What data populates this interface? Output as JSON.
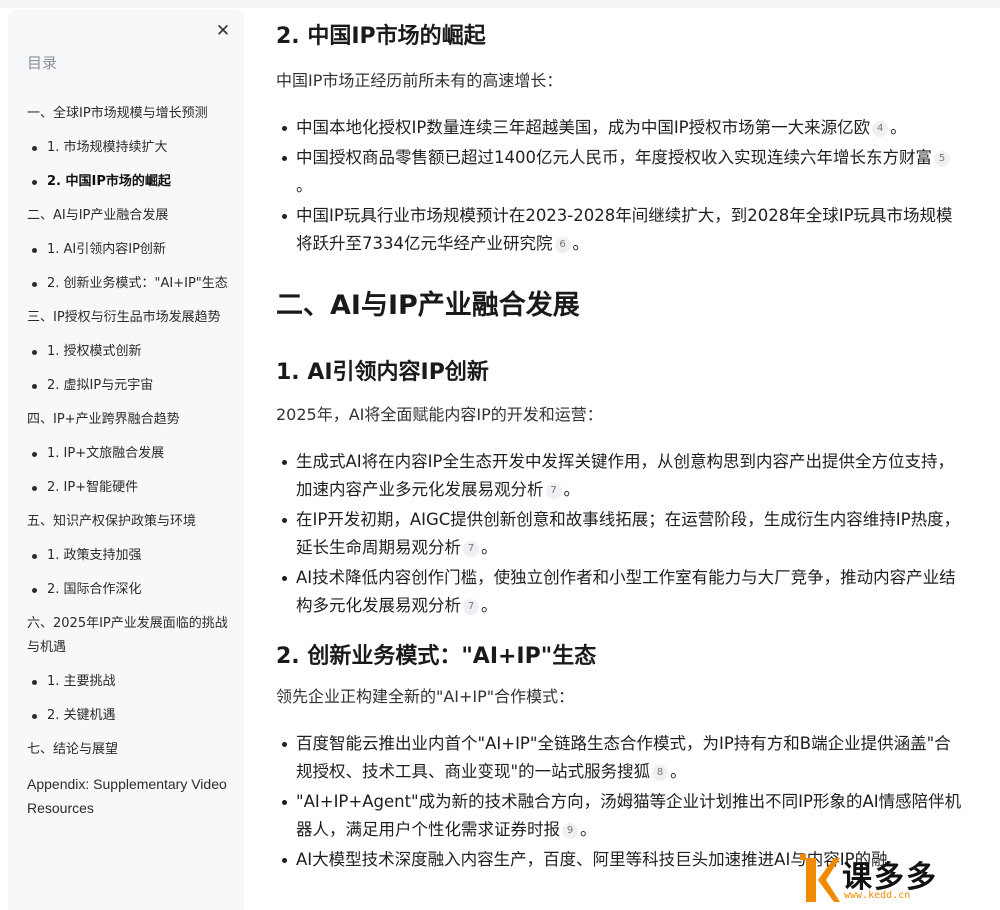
{
  "toc": {
    "title": "目录",
    "items": [
      {
        "level": 1,
        "label": "一、全球IP市场规模与增长预测"
      },
      {
        "level": 2,
        "label": "1. 市场规模持续扩大"
      },
      {
        "level": 2,
        "label": "2. 中国IP市场的崛起",
        "active": true
      },
      {
        "level": 1,
        "label": "二、AI与IP产业融合发展"
      },
      {
        "level": 2,
        "label": "1. AI引领内容IP创新"
      },
      {
        "level": 2,
        "label": "2. 创新业务模式：\"AI+IP\"生态"
      },
      {
        "level": 1,
        "label": "三、IP授权与衍生品市场发展趋势"
      },
      {
        "level": 2,
        "label": "1. 授权模式创新"
      },
      {
        "level": 2,
        "label": "2. 虚拟IP与元宇宙"
      },
      {
        "level": 1,
        "label": "四、IP+产业跨界融合趋势"
      },
      {
        "level": 2,
        "label": "1. IP+文旅融合发展"
      },
      {
        "level": 2,
        "label": "2. IP+智能硬件"
      },
      {
        "level": 1,
        "label": "五、知识产权保护政策与环境"
      },
      {
        "level": 2,
        "label": "1. 政策支持加强"
      },
      {
        "level": 2,
        "label": "2. 国际合作深化"
      },
      {
        "level": 1,
        "label": "六、2025年IP产业发展面临的挑战与机遇"
      },
      {
        "level": 2,
        "label": "1. 主要挑战"
      },
      {
        "level": 2,
        "label": "2. 关键机遇"
      },
      {
        "level": 1,
        "label": "七、结论与展望"
      },
      {
        "level": 1,
        "label": "Appendix: Supplementary Video Resources",
        "appendix": true
      }
    ]
  },
  "content": {
    "s1": {
      "heading": "2. 中国IP市场的崛起",
      "lead": "中国IP市场正经历前所未有的高速增长：",
      "bullets": [
        {
          "text": "中国本地化授权IP数量连续三年超越美国，成为中国IP授权市场第一大来源亿欧",
          "cite": "4",
          "tail": "。"
        },
        {
          "text": "中国授权商品零售额已超过1400亿元人民币，年度授权收入实现连续六年增长东方财富",
          "cite": "5",
          "tail": "。"
        },
        {
          "text": "中国IP玩具行业市场规模预计在2023-2028年间继续扩大，到2028年全球IP玩具市场规模将跃升至7334亿元华经产业研究院",
          "cite": "6",
          "tail": "。"
        }
      ]
    },
    "section2_title": "二、AI与IP产业融合发展",
    "s2": {
      "heading": "1. AI引领内容IP创新",
      "lead": "2025年，AI将全面赋能内容IP的开发和运营：",
      "bullets": [
        {
          "text": "生成式AI将在内容IP全生态开发中发挥关键作用，从创意构思到内容产出提供全方位支持，加速内容产业多元化发展易观分析",
          "cite": "7",
          "tail": "。"
        },
        {
          "text": "在IP开发初期，AIGC提供创新创意和故事线拓展；在运营阶段，生成衍生内容维持IP热度，延长生命周期易观分析",
          "cite": "7",
          "tail": "。"
        },
        {
          "text": "AI技术降低内容创作门槛，使独立创作者和小型工作室有能力与大厂竞争，推动内容产业结构多元化发展易观分析",
          "cite": "7",
          "tail": "。"
        }
      ]
    },
    "s3": {
      "heading": "2. 创新业务模式：\"AI+IP\"生态",
      "lead": "领先企业正构建全新的\"AI+IP\"合作模式：",
      "bullets": [
        {
          "text": "百度智能云推出业内首个\"AI+IP\"全链路生态合作模式，为IP持有方和B端企业提供涵盖\"合规授权、技术工具、商业变现\"的一站式服务搜狐",
          "cite": "8",
          "tail": "。"
        },
        {
          "text": "\"AI+IP+Agent\"成为新的技术融合方向，汤姆猫等企业计划推出不同IP形象的AI情感陪伴机器人，满足用户个性化需求证券时报",
          "cite": "9",
          "tail": "。"
        },
        {
          "text": "AI大模型技术深度融入内容生产，百度、阿里等科技巨头加速推进AI与内容IP的融",
          "cite": "",
          "tail": ""
        }
      ]
    }
  },
  "watermark": {
    "brand": "课多多",
    "url": "www.kedd.cn"
  }
}
